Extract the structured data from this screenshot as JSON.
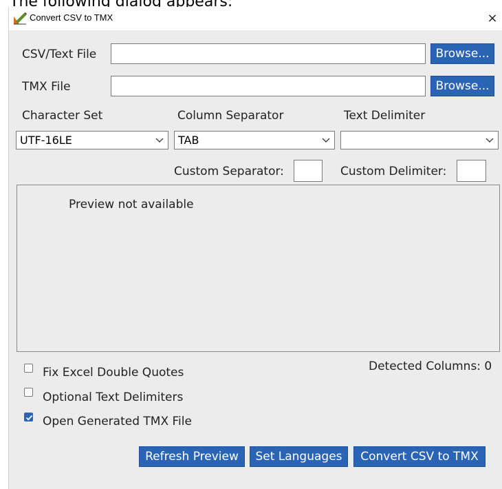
{
  "caption": "The following dialog appears:",
  "window": {
    "title": "Convert CSV to TMX",
    "close_glyph": "×"
  },
  "form": {
    "csv_label": "CSV/Text File",
    "csv_value": "",
    "tmx_label": "TMX File",
    "tmx_value": "",
    "browse_label": "Browse...",
    "charset_label": "Character Set",
    "charset_value": "UTF-16LE",
    "separator_label": "Column Separator",
    "separator_value": "TAB",
    "delimiter_label": "Text Delimiter",
    "delimiter_value": "",
    "custom_separator_label": "Custom Separator:",
    "custom_separator_value": "",
    "custom_delimiter_label": "Custom Delimiter:",
    "custom_delimiter_value": ""
  },
  "preview": {
    "text": "Preview not available"
  },
  "options": {
    "detected_columns": "Detected Columns: 0",
    "fix_quotes": {
      "label": "Fix Excel Double Quotes",
      "checked": false
    },
    "optional_delims": {
      "label": "Optional Text Delimiters",
      "checked": false
    },
    "open_tmx": {
      "label": "Open Generated TMX File",
      "checked": true
    }
  },
  "buttons": {
    "refresh": "Refresh Preview",
    "languages": "Set Languages",
    "convert": "Convert CSV to TMX"
  },
  "colors": {
    "accent": "#2a64b4",
    "dialog_bg": "#ececec"
  },
  "icons": {
    "app": "app-logo-icon",
    "close": "close-icon",
    "dropdown": "chevron-down-icon",
    "check": "checkmark-icon"
  }
}
